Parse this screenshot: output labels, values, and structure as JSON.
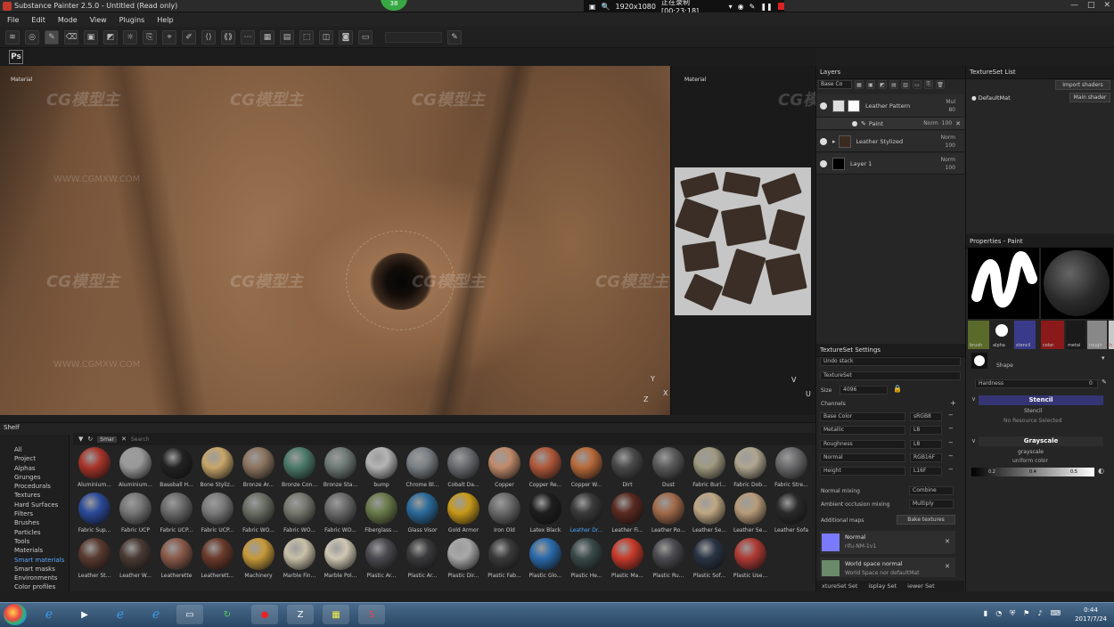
{
  "window": {
    "title": "Substance Painter 2.5.0 - Untitled (Read only)",
    "controls": [
      "—",
      "□",
      "✕"
    ]
  },
  "recorder": {
    "badge": "38",
    "resolution": "1920x1080",
    "status": "正在录制 [00:23:18]"
  },
  "menu": [
    "File",
    "Edit",
    "Mode",
    "View",
    "Plugins",
    "Help"
  ],
  "toolbar": {
    "ps_label": "Ps"
  },
  "viewport": {
    "left_label": "Material",
    "right_label": "Material",
    "axis_left": {
      "y": "Y",
      "x": "X",
      "z": "Z"
    },
    "axis_right": {
      "y": "V",
      "x": "U"
    },
    "watermark": "CG模型主",
    "watermark2": "WWW.CGMXW.COM"
  },
  "shelf": {
    "title": "Shelf",
    "filter_tag": "Smar",
    "search_placeholder": "Search",
    "categories": [
      "All",
      "Project",
      "Alphas",
      "Grunges",
      "Procedurals",
      "Textures",
      "Hard Surfaces",
      "Filters",
      "Brushes",
      "Particles",
      "Tools",
      "Materials",
      "Smart materials",
      "Smart masks",
      "Environments",
      "Color profiles"
    ],
    "selected_category": "Smart materials",
    "materials": [
      {
        "name": "Aluminium...",
        "color": "#a8342a"
      },
      {
        "name": "Aluminium...",
        "color": "#9a9a9a"
      },
      {
        "name": "Baseball H...",
        "color": "#222222"
      },
      {
        "name": "Bone Styliz...",
        "color": "#c8a66a"
      },
      {
        "name": "Bronze Ar...",
        "color": "#8c7560"
      },
      {
        "name": "Bronze Con...",
        "color": "#4c7a6a"
      },
      {
        "name": "Bronze Sta...",
        "color": "#6e7a76"
      },
      {
        "name": "bump",
        "color": "#b4b4b4"
      },
      {
        "name": "Chrome Bl...",
        "color": "#7a8086"
      },
      {
        "name": "Cobalt Da...",
        "color": "#6a6c70"
      },
      {
        "name": "Copper",
        "color": "#c08a6a"
      },
      {
        "name": "Copper Re...",
        "color": "#b0583a"
      },
      {
        "name": "Copper W...",
        "color": "#b86a3a"
      },
      {
        "name": "Dirt",
        "color": "#4a4a4a"
      },
      {
        "name": "Dust",
        "color": "#5a5a5a"
      },
      {
        "name": "Fabric Burl...",
        "color": "#a09a80"
      },
      {
        "name": "Fabric Dob...",
        "color": "#b0a690"
      },
      {
        "name": "Fabric Stre...",
        "color": "#6a6a6c"
      },
      {
        "name": "Fabric Sup...",
        "color": "#2a4a9a"
      },
      {
        "name": "Fabric UCP",
        "color": "#767676"
      },
      {
        "name": "Fabric UCP...",
        "color": "#6a6a6a"
      },
      {
        "name": "Fabric UCP...",
        "color": "#7a7a7a"
      },
      {
        "name": "Fabric WO...",
        "color": "#6a6e64"
      },
      {
        "name": "Fabric WO...",
        "color": "#76786e"
      },
      {
        "name": "Fabric WO...",
        "color": "#6a6a6a"
      },
      {
        "name": "Fiberglass ...",
        "color": "#6a7a4a"
      },
      {
        "name": "Glass Visor",
        "color": "#2a6a9a"
      },
      {
        "name": "Gold Armor",
        "color": "#c89a1a"
      },
      {
        "name": "Iron Old",
        "color": "#6a6a6a"
      },
      {
        "name": "Latex Black",
        "color": "#1e1e1e"
      },
      {
        "name": "Leather Dr...",
        "color": "#3a3a3a"
      },
      {
        "name": "Leather Fi...",
        "color": "#5a2a20"
      },
      {
        "name": "Leather Ro...",
        "color": "#a06a4a"
      },
      {
        "name": "Leather Se...",
        "color": "#c0a884"
      },
      {
        "name": "Leather Se...",
        "color": "#b89c7a"
      },
      {
        "name": "Leather Sofa",
        "color": "#2a2a2a"
      },
      {
        "name": "Leather St...",
        "color": "#5a3a30"
      },
      {
        "name": "Leather W...",
        "color": "#4a3a34"
      },
      {
        "name": "Leatherette",
        "color": "#8a5a4a"
      },
      {
        "name": "Leatherett...",
        "color": "#6a3a2a"
      },
      {
        "name": "Machinery",
        "color": "#c89a3a"
      },
      {
        "name": "Marble Fin...",
        "color": "#c8c0a8"
      },
      {
        "name": "Marble Pol...",
        "color": "#d0c8b4"
      },
      {
        "name": "Plastic Ar...",
        "color": "#4a4a50"
      },
      {
        "name": "Plastic Ar...",
        "color": "#3a3a3c"
      },
      {
        "name": "Plastic Dir...",
        "color": "#a8a8a8"
      },
      {
        "name": "Plastic Fab...",
        "color": "#3a3a3a"
      },
      {
        "name": "Plastic Glo...",
        "color": "#2a6aaa"
      },
      {
        "name": "Plastic He...",
        "color": "#3a4a4a"
      },
      {
        "name": "Plastic Ma...",
        "color": "#c83a2a"
      },
      {
        "name": "Plastic Ru...",
        "color": "#4a4a50"
      },
      {
        "name": "Plastic Sof...",
        "color": "#2a3444"
      },
      {
        "name": "Plastic Use...",
        "color": "#b03a34"
      }
    ],
    "selected_material_index": 30
  },
  "layers": {
    "title": "Layers",
    "blend_select": "Base Co",
    "items": [
      {
        "name": "Leather Pattern",
        "blend": "Mul",
        "opacity": "80"
      },
      {
        "name": "Paint",
        "blend": "Norm",
        "opacity": "100"
      },
      {
        "name": "Leather Stylized",
        "blend": "Norm",
        "opacity": "100"
      },
      {
        "name": "Layer 1",
        "blend": "Norm",
        "opacity": "100"
      }
    ]
  },
  "textureset_list": {
    "title": "TextureSet List",
    "import_button": "Import shaders",
    "item": "DefaultMat",
    "shader_button": "Main shader"
  },
  "textureset_settings": {
    "title": "TextureSet Settings",
    "undo_stack": "Undo stack",
    "textureset_label": "TextureSet",
    "size_label": "Size",
    "size_value": "4096",
    "channels_label": "Channels",
    "channels": [
      {
        "name": "Base Color",
        "format": "sRGB8"
      },
      {
        "name": "Metallic",
        "format": "L8"
      },
      {
        "name": "Roughness",
        "format": "L8"
      },
      {
        "name": "Normal",
        "format": "RGB16F"
      },
      {
        "name": "Height",
        "format": "L16F"
      }
    ],
    "normal_mixing_label": "Normal mixing",
    "normal_mixing_value": "Combine",
    "ao_mixing_label": "Ambient occlusion mixing",
    "ao_mixing_value": "Multiply",
    "additional_maps_label": "Additional maps",
    "bake_button": "Bake textures",
    "maps": [
      {
        "name": "Normal",
        "sub": "rifu-NM-1v1",
        "color": "#7a7aff"
      },
      {
        "name": "World space normal",
        "sub": "World Space nor defaultMat",
        "color": "#6a8a6a"
      }
    ],
    "tabs": [
      "xtureSet Set",
      "isplay Set",
      "iewer Set"
    ]
  },
  "properties": {
    "title": "Properties - Paint",
    "slots": [
      "brush",
      "alpha",
      "stencil",
      "color",
      "metal",
      "rough",
      "h"
    ],
    "shape_label": "Shape",
    "hardness_label": "Hardness",
    "hardness_value": "0",
    "stencil_header": "Stencil",
    "stencil_sub": "Stencil",
    "stencil_value": "No Resource Selected",
    "grayscale_header": "Grayscale",
    "grayscale_sub": "grayscale",
    "grayscale_value": "uniform color",
    "gray_ticks": [
      "0.2",
      "0.4",
      "0.5"
    ]
  },
  "taskbar": {
    "time": "0:44",
    "date": "2017/7/24"
  }
}
